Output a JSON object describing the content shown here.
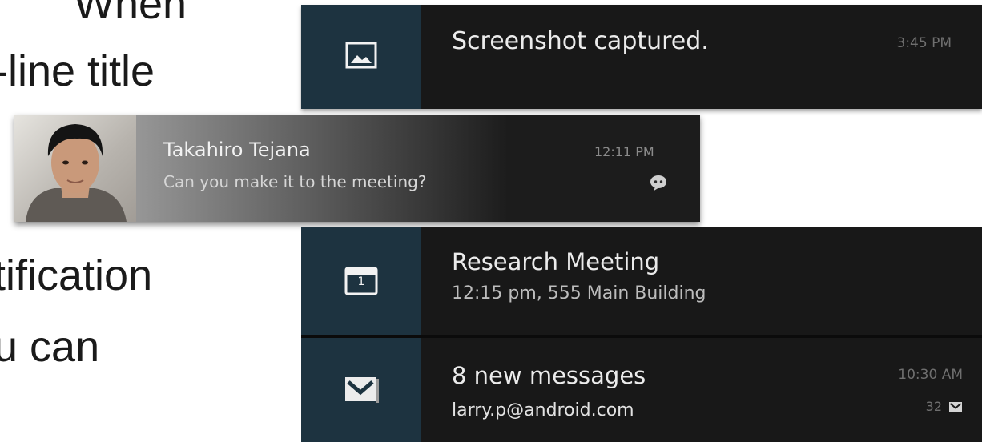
{
  "background_text": [
    "When",
    "-line title",
    "tification",
    "u can"
  ],
  "notifications": {
    "screenshot": {
      "title": "Screenshot captured.",
      "time": "3:45 PM",
      "icon": "picture-icon"
    },
    "chat": {
      "sender": "Takahiro Tejana",
      "message": "Can you make it to the meeting?",
      "time": "12:11 PM",
      "icon": "chat-bubble-icon"
    },
    "calendar": {
      "title": "Research Meeting",
      "detail": "12:15 pm, 555 Main Building",
      "icon": "calendar-icon",
      "icon_number": "1"
    },
    "gmail": {
      "title": "8 new messages",
      "account": "larry.p@android.com",
      "time": "10:30 AM",
      "count": "32",
      "icon": "gmail-icon"
    }
  },
  "colors": {
    "notification_bg": "#181818",
    "icon_column": "#1d3340"
  }
}
